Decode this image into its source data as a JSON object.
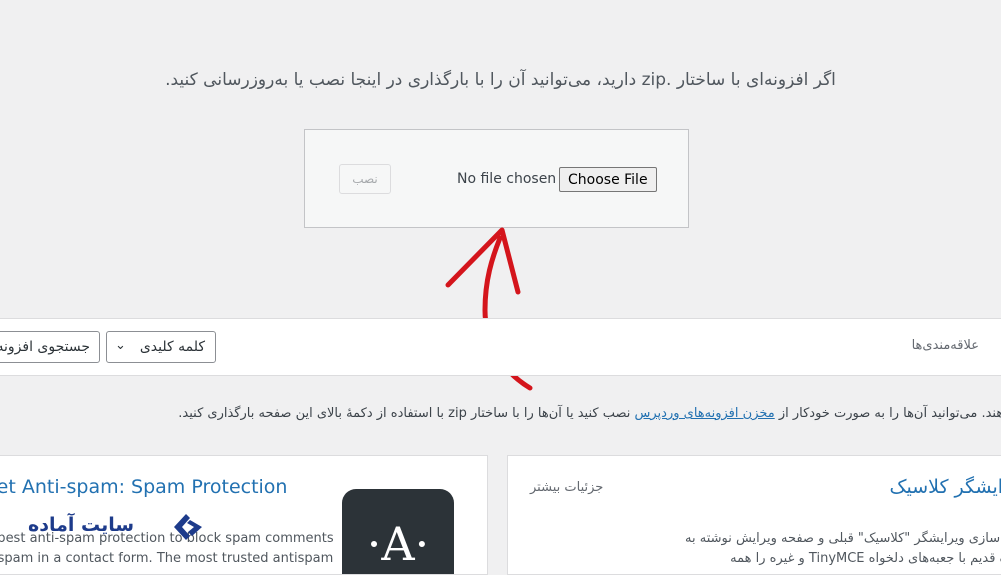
{
  "upload": {
    "intro_text": "اگر افزونه‌ای با ساختار .zip دارید، می‌توانید آن را با بارگذاری در اینجا نصب یا به‌روزرسانی کنید.",
    "choose_file_label": "Choose File",
    "no_file_text": "No file chosen",
    "install_label": "نصب"
  },
  "filter": {
    "favorites_tab": "علاقه‌مندی‌ها",
    "search_type_selected": "کلمه کلیدی",
    "search_placeholder": "جستجوی افزونه"
  },
  "info": {
    "prefix": "دهند. می‌توانید آن‌ها را به صورت خودکار از ",
    "link": "مخزن افزونه‌های وردپرس",
    "suffix": " نصب کنید یا آن‌ها را با ساختار zip با استفاده از دکمهٔ بالای این صفحه بارگذاری کنید."
  },
  "cards": [
    {
      "title": "Akismet Anti-spam: Spam Protection",
      "desc_line1": "The best anti-spam protection to block spam comments",
      "desc_line2": "and spam in a contact form. The most trusted antispam",
      "icon_letter": "·A·"
    },
    {
      "title": "ویرایشگر کلاسیک",
      "more_details": "جزئیات بیشتر",
      "desc_line1": "فعال‌سازی ویرایشگر \"کلاسیک\" قبلی و صفحه ویرایش نوشته به",
      "desc_line2": "سبک قدیم با جعبه‌های دلخواه TinyMCE و غیره را همه"
    }
  ],
  "watermark": {
    "text": "سایت آماده"
  },
  "colors": {
    "link": "#2271b1",
    "background": "#f0f0f1",
    "arrow": "#d4151c",
    "logo": "#1d3b8b"
  }
}
